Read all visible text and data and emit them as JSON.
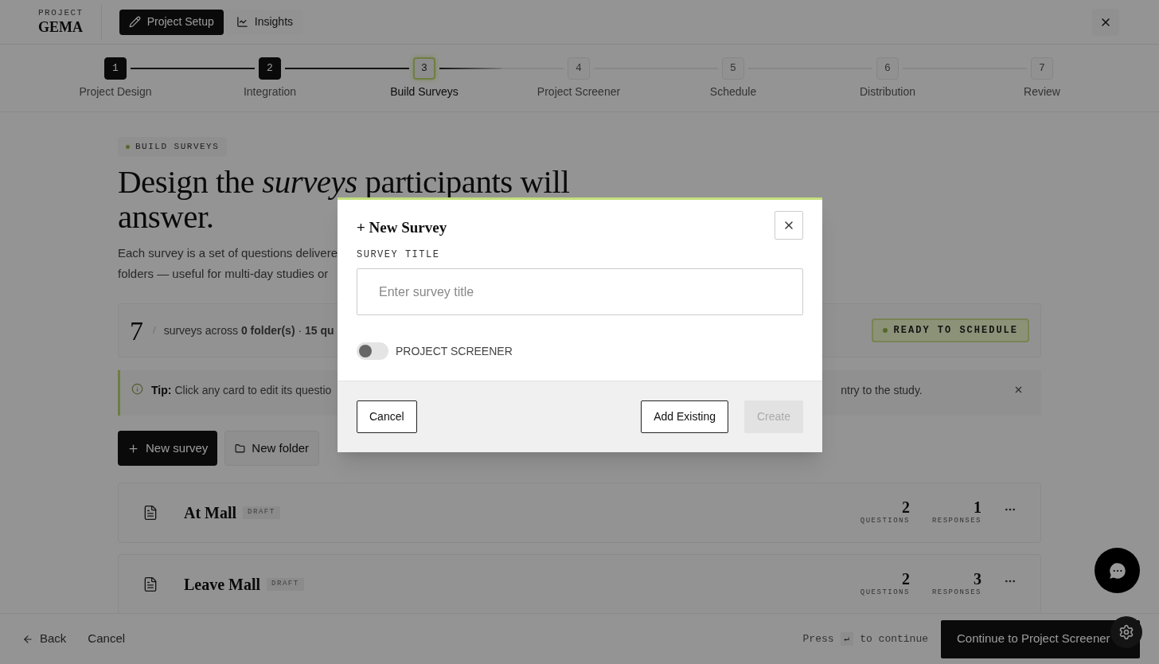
{
  "header": {
    "eyebrow": "PROJECT",
    "project_name": "GEMA",
    "tabs": [
      {
        "label": "Project Setup",
        "kind": "edit",
        "selected": true
      },
      {
        "label": "Insights",
        "kind": "chart",
        "selected": false
      }
    ]
  },
  "stepper": [
    {
      "number": "1",
      "label": "Project Design",
      "completed": true,
      "selected": false
    },
    {
      "number": "2",
      "label": "Integration",
      "completed": true,
      "selected": false
    },
    {
      "number": "3",
      "label": "Build Surveys",
      "completed": false,
      "selected": true
    },
    {
      "number": "4",
      "label": "Project Screener",
      "completed": false,
      "selected": false
    },
    {
      "number": "5",
      "label": "Schedule",
      "completed": false,
      "selected": false
    },
    {
      "number": "6",
      "label": "Distribution",
      "completed": false,
      "selected": false
    },
    {
      "number": "7",
      "label": "Review",
      "completed": false,
      "selected": false
    }
  ],
  "section_badge": "BUILD SURVEYS",
  "heading": {
    "line_1": "Design the *surveys* participants will",
    "line_2": "answer."
  },
  "description_lines": [
    "Each survey is a set of questions delivere",
    "folders — useful for multi-day studies or"
  ],
  "summary": {
    "count": "7",
    "slash": "/",
    "text": "surveys across **0 folder(s)** · **15 qu**",
    "status": "READY TO SCHEDULE"
  },
  "tip": {
    "label": "Tip:",
    "text_left": "Click any card to edit its questio",
    "text_right": "ntry to the study."
  },
  "actions": [
    {
      "label": "New survey",
      "kind": "primary"
    },
    {
      "label": "New folder",
      "kind": "secondary"
    }
  ],
  "surveys": [
    {
      "title": "At Mall",
      "badge": "DRAFT",
      "questions": "2",
      "questions_label": "QUESTIONS",
      "responses": "1",
      "responses_label": "RESPONSES"
    },
    {
      "title": "Leave Mall",
      "badge": "DRAFT",
      "questions": "2",
      "questions_label": "QUESTIONS",
      "responses": "3",
      "responses_label": "RESPONSES"
    }
  ],
  "footer": {
    "back": "Back",
    "cancel": "Cancel",
    "hint_before": "Press",
    "hint_key": "↵",
    "hint_after": "to continue",
    "continue": "Continue to Project Screener"
  },
  "modal": {
    "title": "+ New Survey",
    "field_label": "SURVEY TITLE",
    "placeholder": "Enter survey title",
    "toggle_label": "PROJECT SCREENER",
    "toggle_on": false,
    "buttons": [
      {
        "label": "Cancel",
        "kind": "outline",
        "disabled": false
      },
      {
        "label": "Add Existing",
        "kind": "outline",
        "disabled": false
      },
      {
        "label": "Create",
        "kind": "primary",
        "disabled": true
      }
    ]
  }
}
